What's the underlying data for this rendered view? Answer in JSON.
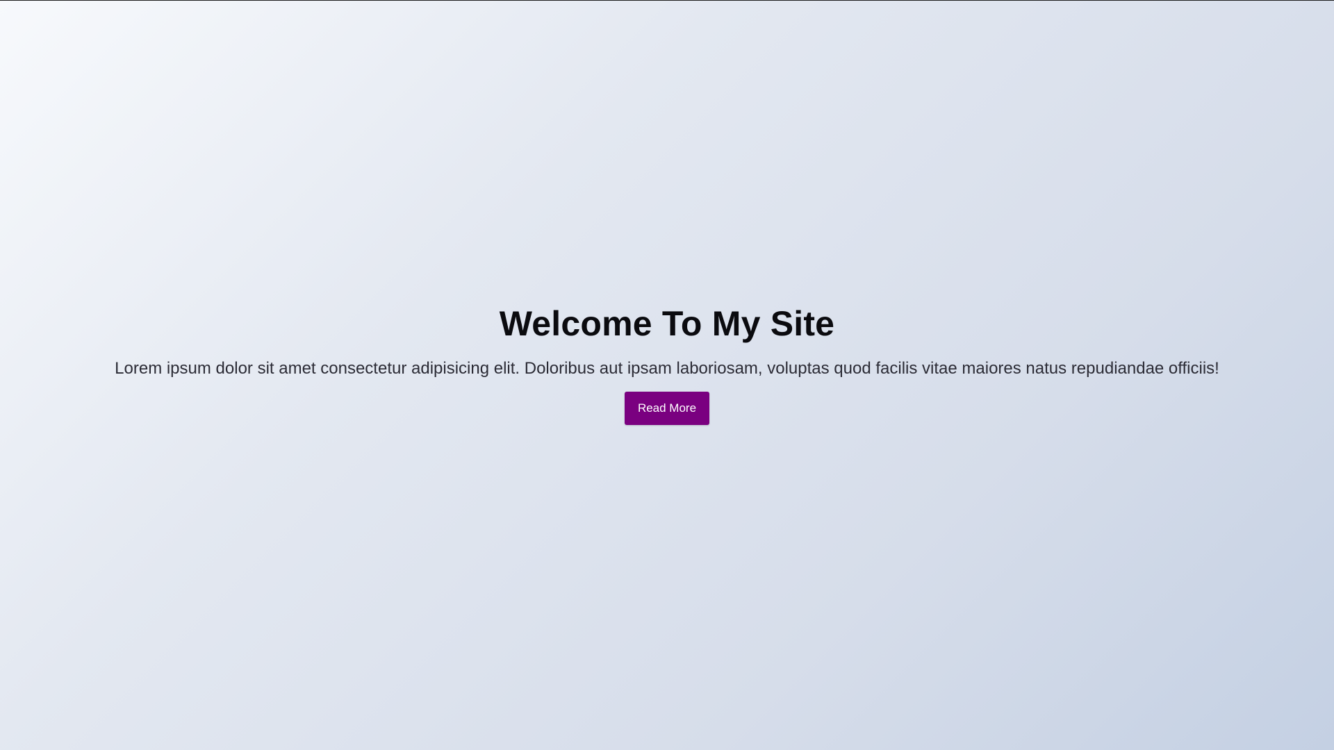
{
  "hero": {
    "title": "Welcome To My Site",
    "text": "Lorem ipsum dolor sit amet consectetur adipisicing elit. Doloribus aut ipsam laboriosam, voluptas quod facilis vitae maiores natus repudiandae officiis!",
    "button_label": "Read More"
  },
  "colors": {
    "accent": "#7a0080",
    "background_start": "#f7f9fc",
    "background_end": "#c4d0e3",
    "title_text": "#0b0b0f"
  }
}
